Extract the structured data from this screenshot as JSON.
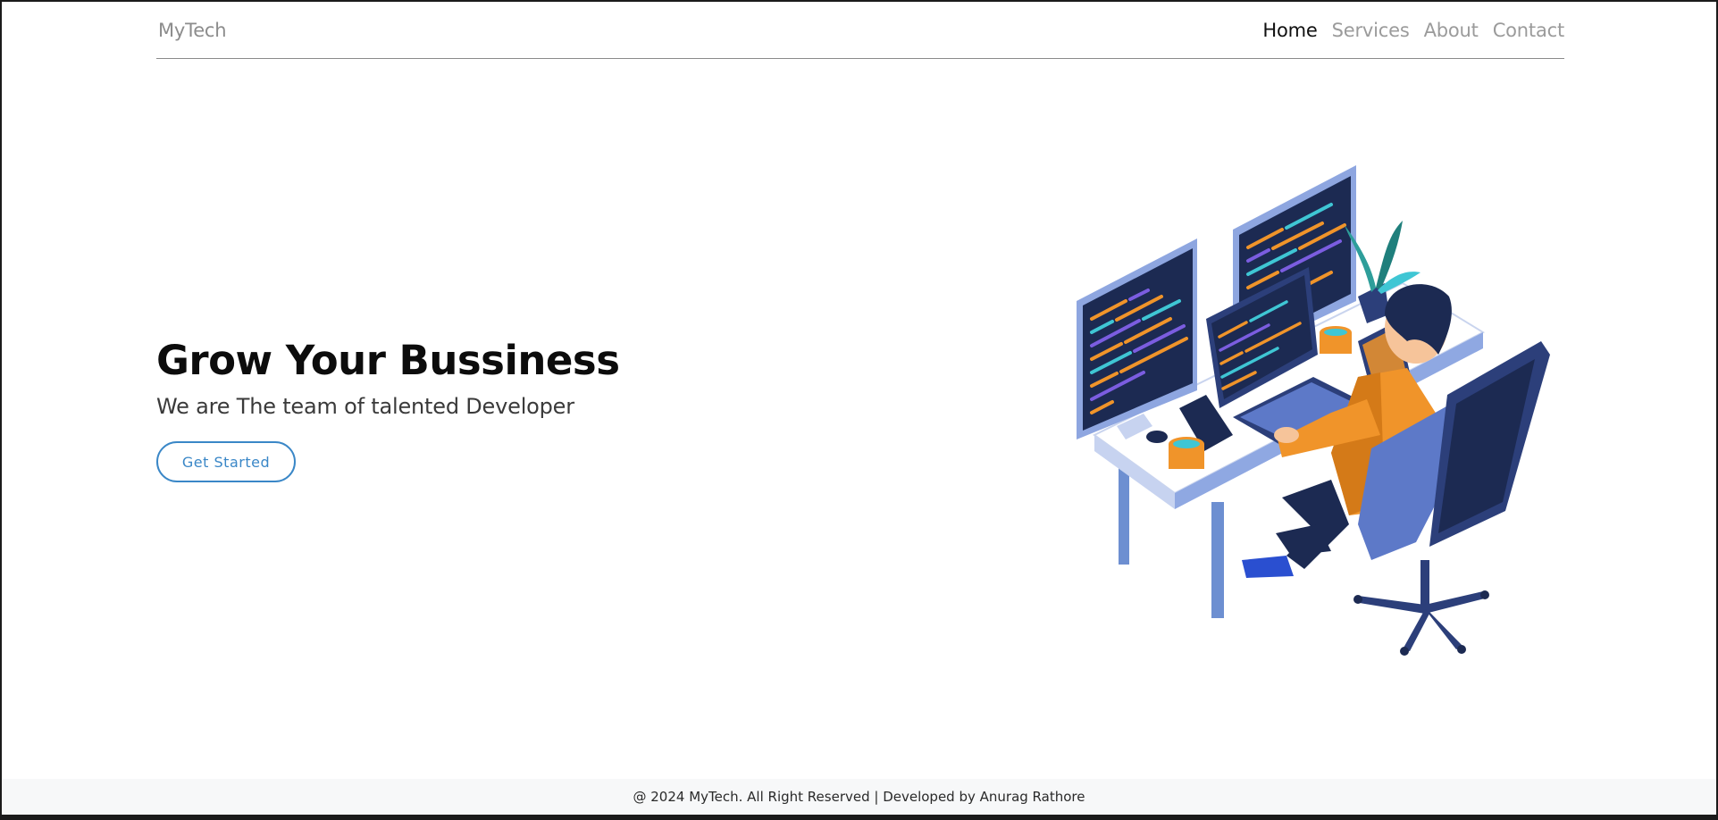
{
  "navbar": {
    "brand": "MyTech",
    "links": [
      {
        "label": "Home",
        "active": true
      },
      {
        "label": "Services",
        "active": false
      },
      {
        "label": "About",
        "active": false
      },
      {
        "label": "Contact",
        "active": false
      }
    ]
  },
  "hero": {
    "title": "Grow Your Bussiness",
    "subtitle": "We are The team of talented Developer",
    "cta_label": "Get Started",
    "illustration_icon": "developer-at-desk-illustration"
  },
  "footer": {
    "text": "@ 2024 MyTech. All Right Reserved | Developed by Anurag Rathore"
  },
  "colors": {
    "accent": "#3a87c7",
    "nav_inactive": "#9b9b9b",
    "nav_active": "#111111",
    "footer_bg": "#f7f8f9"
  }
}
